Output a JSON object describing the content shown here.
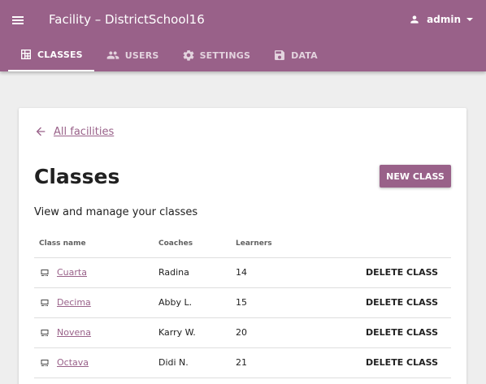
{
  "appbar": {
    "title": "Facility – DistrictSchool16",
    "user": "admin",
    "tabs": [
      {
        "label": "CLASSES",
        "icon": "classes-icon",
        "active": true
      },
      {
        "label": "USERS",
        "icon": "users-icon",
        "active": false
      },
      {
        "label": "SETTINGS",
        "icon": "gear-icon",
        "active": false
      },
      {
        "label": "DATA",
        "icon": "save-icon",
        "active": false
      }
    ]
  },
  "colors": {
    "brand": "#996189",
    "background": "#eeeeee"
  },
  "main": {
    "back_link": "All facilities",
    "title": "Classes",
    "new_button": "NEW CLASS",
    "subtitle": "View and manage your classes",
    "table": {
      "headers": [
        "Class name",
        "Coaches",
        "Learners"
      ],
      "rows": [
        {
          "name": "Cuarta",
          "coach": "Radina",
          "learners": "14",
          "action": "DELETE CLASS"
        },
        {
          "name": "Decima",
          "coach": "Abby L.",
          "learners": "15",
          "action": "DELETE CLASS"
        },
        {
          "name": "Novena",
          "coach": "Karry W.",
          "learners": "20",
          "action": "DELETE CLASS"
        },
        {
          "name": "Octava",
          "coach": "Didi N.",
          "learners": "21",
          "action": "DELETE CLASS"
        }
      ]
    }
  }
}
